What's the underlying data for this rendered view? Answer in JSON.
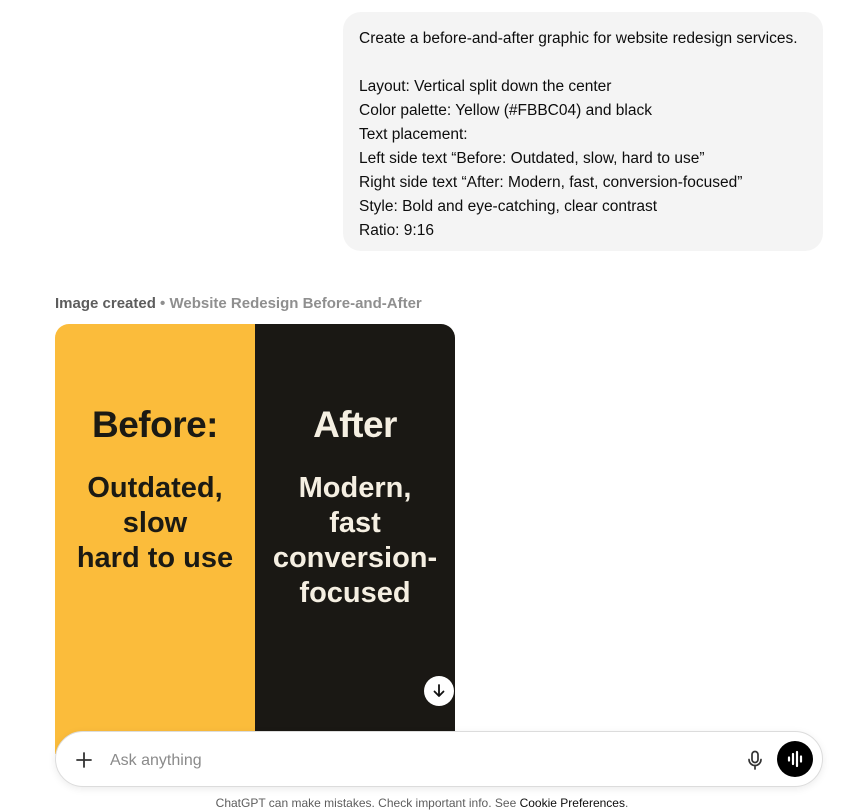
{
  "user_message": {
    "lines": [
      "Create a before-and-after graphic for website redesign services.",
      "",
      "Layout: Vertical split down the center",
      "Color palette: Yellow (#FBBC04) and black",
      "Text placement:",
      "Left side text “Before: Outdated, slow, hard to use”",
      "Right side text “After: Modern, fast, conversion-focused”",
      "Style: Bold and eye-catching, clear contrast",
      "Ratio: 9:16"
    ]
  },
  "assistant": {
    "status": "Image created",
    "separator": " • ",
    "image_title": "Website Redesign Before-and-After"
  },
  "image": {
    "left": {
      "heading": "Before:",
      "lines": [
        "Outdated,",
        "slow",
        "hard to use"
      ],
      "color": "#fbbc3b"
    },
    "right": {
      "heading": "After",
      "lines": [
        "Modern,",
        "fast",
        "conversion-",
        "focused"
      ],
      "color": "#1a1814"
    },
    "download_icon": "arrow-down-icon"
  },
  "composer": {
    "placeholder": "Ask anything",
    "icons": [
      "plus-icon",
      "mic-icon",
      "voice-waveform-icon"
    ]
  },
  "footer": {
    "text": "ChatGPT can make mistakes. Check important info. See ",
    "link": "Cookie Preferences",
    "end": "."
  }
}
